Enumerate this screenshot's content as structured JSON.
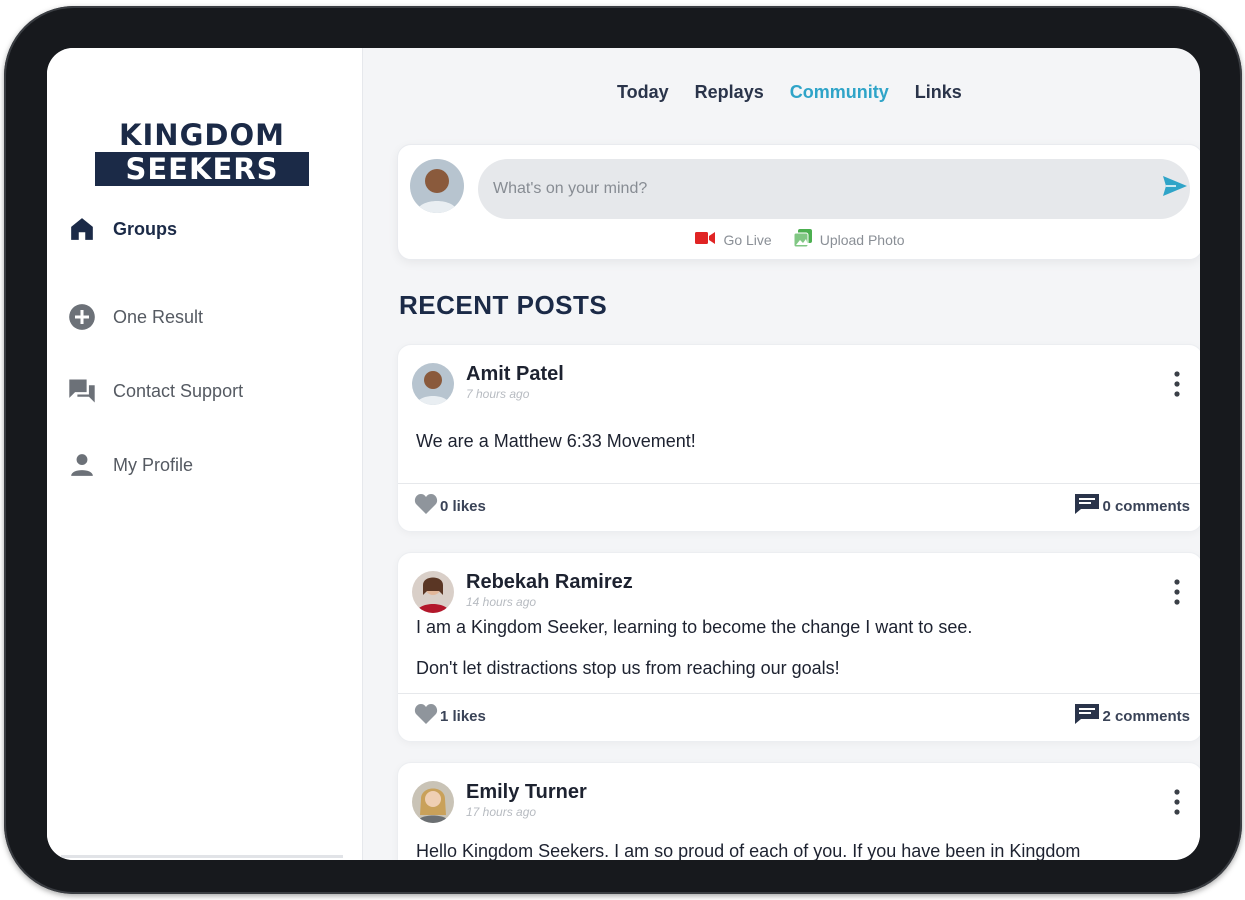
{
  "brand": {
    "logo_top": "KINGDOM",
    "logo_bottom": "SEEKERS"
  },
  "sidebar": {
    "items": [
      {
        "label": "Groups",
        "icon": "home-icon",
        "active": true
      },
      {
        "label": "One Result",
        "icon": "plus-circle-icon",
        "active": false
      },
      {
        "label": "Contact Support",
        "icon": "chat-bubbles-icon",
        "active": false
      },
      {
        "label": "My Profile",
        "icon": "person-icon",
        "active": false
      }
    ]
  },
  "tabs": [
    {
      "label": "Today",
      "active": false
    },
    {
      "label": "Replays",
      "active": false
    },
    {
      "label": "Community",
      "active": true
    },
    {
      "label": "Links",
      "active": false
    }
  ],
  "composer": {
    "placeholder": "What's on your mind?",
    "go_live_label": "Go Live",
    "upload_photo_label": "Upload Photo"
  },
  "section_title": "RECENT POSTS",
  "posts": [
    {
      "author": "Amit Patel",
      "time": "7 hours ago",
      "lines": [
        "We are a Matthew 6:33 Movement!"
      ],
      "likes": "0 likes",
      "comments": "0 comments"
    },
    {
      "author": "Rebekah Ramirez",
      "time": "14 hours ago",
      "lines": [
        "I am a Kingdom Seeker, learning to become the change I want to see.",
        "Don't let distractions stop us from reaching our goals!"
      ],
      "likes": "1 likes",
      "comments": "2 comments"
    },
    {
      "author": "Emily Turner",
      "time": "17 hours ago",
      "lines": [
        "Hello Kingdom Seekers. I am so proud of each of you. If you have been in Kingdom"
      ]
    }
  ],
  "colors": {
    "brand_navy": "#1b2a47",
    "active_tab": "#2fa4c8",
    "send": "#2fa4c8",
    "live_red": "#e02424",
    "photo_green": "#4caf50"
  }
}
